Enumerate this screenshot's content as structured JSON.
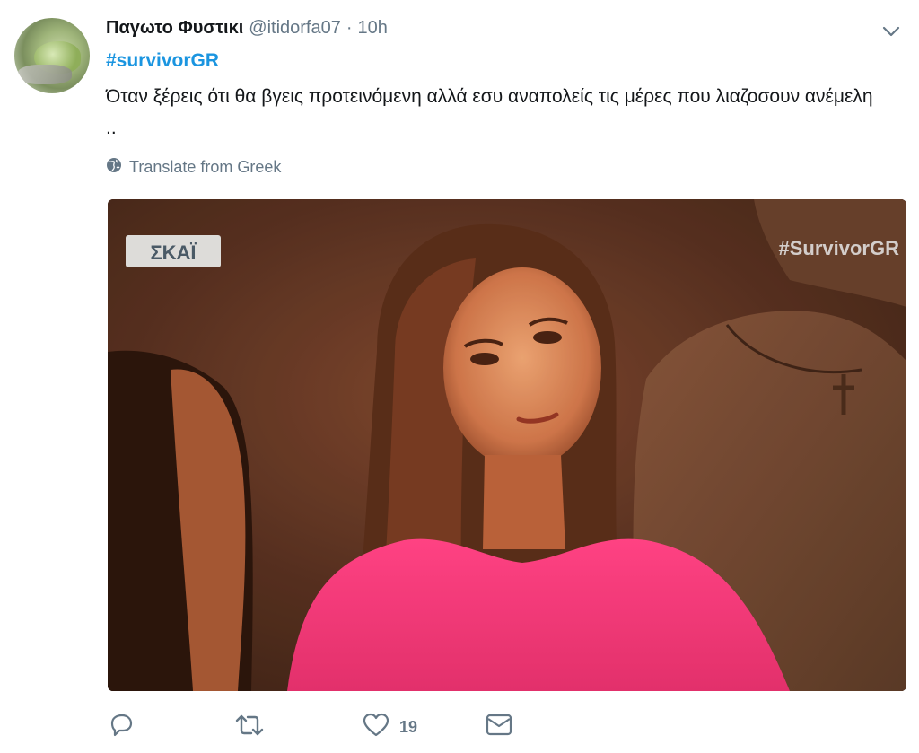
{
  "tweet": {
    "display_name": "Παγωτο Φυστικι",
    "handle": "@itidorfa07",
    "separator": "·",
    "time": "10h",
    "hashtag": "#survivorGR",
    "text": "Όταν ξέρεις ότι θα βγεις προτεινόμενη αλλά εσυ αναπολείς τις μέρες που λιαζοσουν ανέμελη ..",
    "translate_label": "Translate from Greek"
  },
  "media": {
    "channel_logo": "ΣΚΑΪ",
    "watermark": "#SurvivorGR"
  },
  "actions": {
    "reply_icon": "reply-icon",
    "retweet_icon": "retweet-icon",
    "like_icon": "heart-icon",
    "like_count": "19",
    "dm_icon": "envelope-icon"
  },
  "colors": {
    "link": "#1b95e0",
    "muted": "#657786",
    "text": "#14171a"
  }
}
